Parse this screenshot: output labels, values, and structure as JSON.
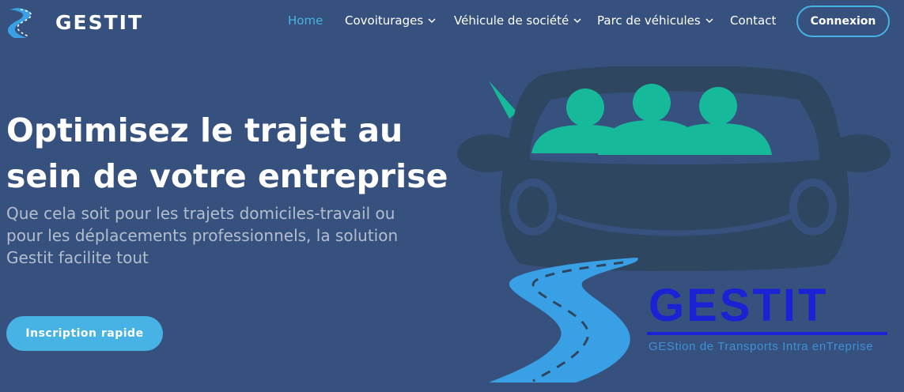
{
  "brand": {
    "name": "GESTIT",
    "icon": "road-logo-icon"
  },
  "nav": {
    "items": [
      {
        "label": "Home",
        "active": true,
        "has_dropdown": false
      },
      {
        "label": "Covoiturages",
        "active": false,
        "has_dropdown": true
      },
      {
        "label": "Véhicule de société",
        "active": false,
        "has_dropdown": true
      },
      {
        "label": "Parc de véhicules",
        "active": false,
        "has_dropdown": true
      },
      {
        "label": "Contact",
        "active": false,
        "has_dropdown": false
      }
    ],
    "login_label": "Connexion"
  },
  "hero": {
    "title_line1": "Optimisez le trajet au",
    "title_line2": "sein de votre entreprise",
    "subtitle_line1": "Que cela soit pour les trajets domiciles-travail ou",
    "subtitle_line2": "pour les déplacements professionnels, la solution",
    "subtitle_line3": "Gestit facilite tout",
    "cta_label": "Inscription rapide"
  },
  "illustration": {
    "icon": "carpool-car-icon",
    "logo_text": "GESTIT",
    "tagline": "GEStion de Transports Intra enTreprise"
  },
  "colors": {
    "background": "#37517e",
    "accent": "#47b2e4",
    "car_body": "#2f4660",
    "passengers": "#16b99a",
    "logo_blue": "#1a22d4",
    "road_blue": "#3aa0e6"
  }
}
